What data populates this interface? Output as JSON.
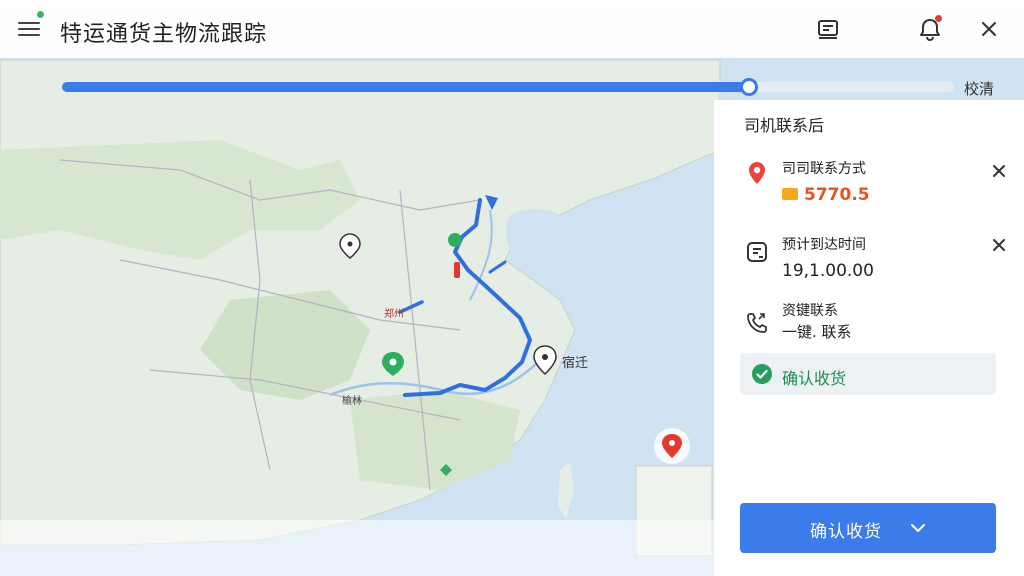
{
  "header": {
    "title": "特运通货主物流跟踪",
    "icons": [
      "menu-icon",
      "list-icon",
      "bell-icon",
      "close-icon"
    ]
  },
  "progress": {
    "value": 0.77,
    "label": "校清"
  },
  "map": {
    "labels": {
      "city_east": "宿迁",
      "city_west": "榆林",
      "city_mid": "郑州"
    }
  },
  "panel": {
    "title": "司机联系后",
    "contact": {
      "label": "司司联系方式",
      "value": "5770.5",
      "color": "#e8541e"
    },
    "arrival": {
      "label": "预计到达时间",
      "value": "19,1.00.00"
    },
    "quick": {
      "label": "资键联系",
      "sub": "一键. 联系"
    },
    "confirm_row_label": "确认收货"
  },
  "primary_button": {
    "label": "确认收货"
  },
  "colors": {
    "accent": "#3b7bea",
    "success": "#21a15b",
    "route": "#2f6fe0"
  }
}
